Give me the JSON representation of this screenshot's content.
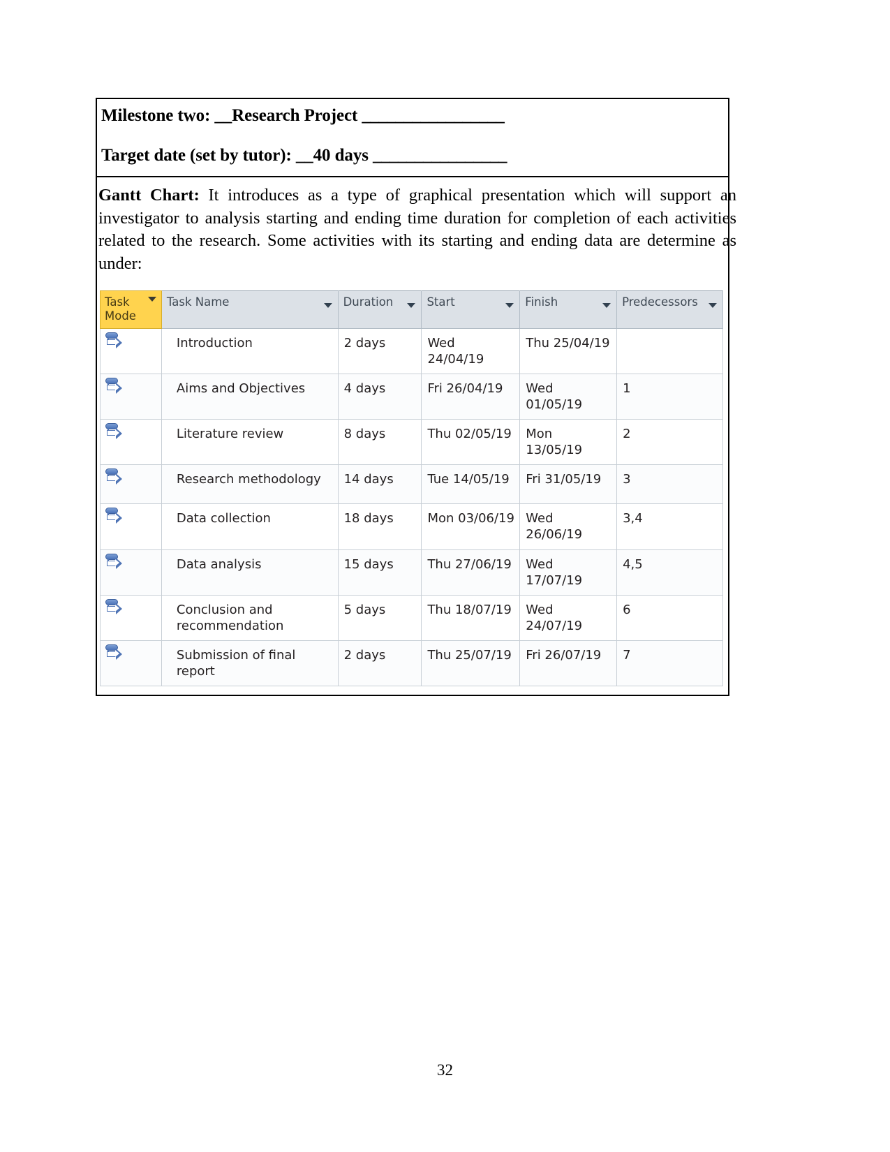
{
  "document": {
    "page_number": "32",
    "heading_lines": [
      {
        "label": "Milestone two:",
        "value": "__Research Project",
        "rule": "_________________"
      },
      {
        "label": "Target date (set by tutor):",
        "value": "__40 days",
        "rule": "________________"
      }
    ],
    "paragraph": {
      "lead": "Gantt Chart:",
      "body": " It introduces as a type of graphical presentation which will support an investigator to analysis starting and ending time duration for completion of each activities related to the research. Some activities with its starting and ending data are determine as under:"
    }
  },
  "project_table": {
    "columns": [
      {
        "key": "task_mode",
        "label": "Task Mode",
        "has_filter_arrow": true,
        "highlight_color": "#ffd34e"
      },
      {
        "key": "task_name",
        "label": "Task Name",
        "has_filter_arrow": true
      },
      {
        "key": "duration",
        "label": "Duration",
        "has_filter_arrow": true
      },
      {
        "key": "start",
        "label": "Start",
        "has_filter_arrow": true
      },
      {
        "key": "finish",
        "label": "Finish",
        "has_filter_arrow": true
      },
      {
        "key": "predecessors",
        "label": "Predecessors",
        "has_filter_arrow": true
      }
    ],
    "mode_icon_name": "auto-scheduled-icon",
    "rows": [
      {
        "mode": "auto-scheduled",
        "name": "Introduction",
        "duration": "2 days",
        "start": "Wed 24/04/19",
        "finish": "Thu 25/04/19",
        "predecessors": ""
      },
      {
        "mode": "auto-scheduled",
        "name": "Aims and Objectives",
        "duration": "4 days",
        "start": "Fri 26/04/19",
        "finish": "Wed 01/05/19",
        "predecessors": "1"
      },
      {
        "mode": "auto-scheduled",
        "name": "Literature review",
        "duration": "8 days",
        "start": "Thu 02/05/19",
        "finish": "Mon 13/05/19",
        "predecessors": "2"
      },
      {
        "mode": "auto-scheduled",
        "name": "Research methodology",
        "duration": "14 days",
        "start": "Tue 14/05/19",
        "finish": "Fri 31/05/19",
        "predecessors": "3"
      },
      {
        "mode": "auto-scheduled",
        "name": "Data collection",
        "duration": "18 days",
        "start": "Mon 03/06/19",
        "finish": "Wed 26/06/19",
        "predecessors": "3,4"
      },
      {
        "mode": "auto-scheduled",
        "name": "Data analysis",
        "duration": "15 days",
        "start": "Thu 27/06/19",
        "finish": "Wed 17/07/19",
        "predecessors": "4,5"
      },
      {
        "mode": "auto-scheduled",
        "name": "Conclusion and recommendation",
        "duration": "5 days",
        "start": "Thu 18/07/19",
        "finish": "Wed 24/07/19",
        "predecessors": "6"
      },
      {
        "mode": "auto-scheduled",
        "name": "Submission of final report",
        "duration": "2 days",
        "start": "Thu 25/07/19",
        "finish": "Fri 26/07/19",
        "predecessors": "7"
      }
    ]
  }
}
